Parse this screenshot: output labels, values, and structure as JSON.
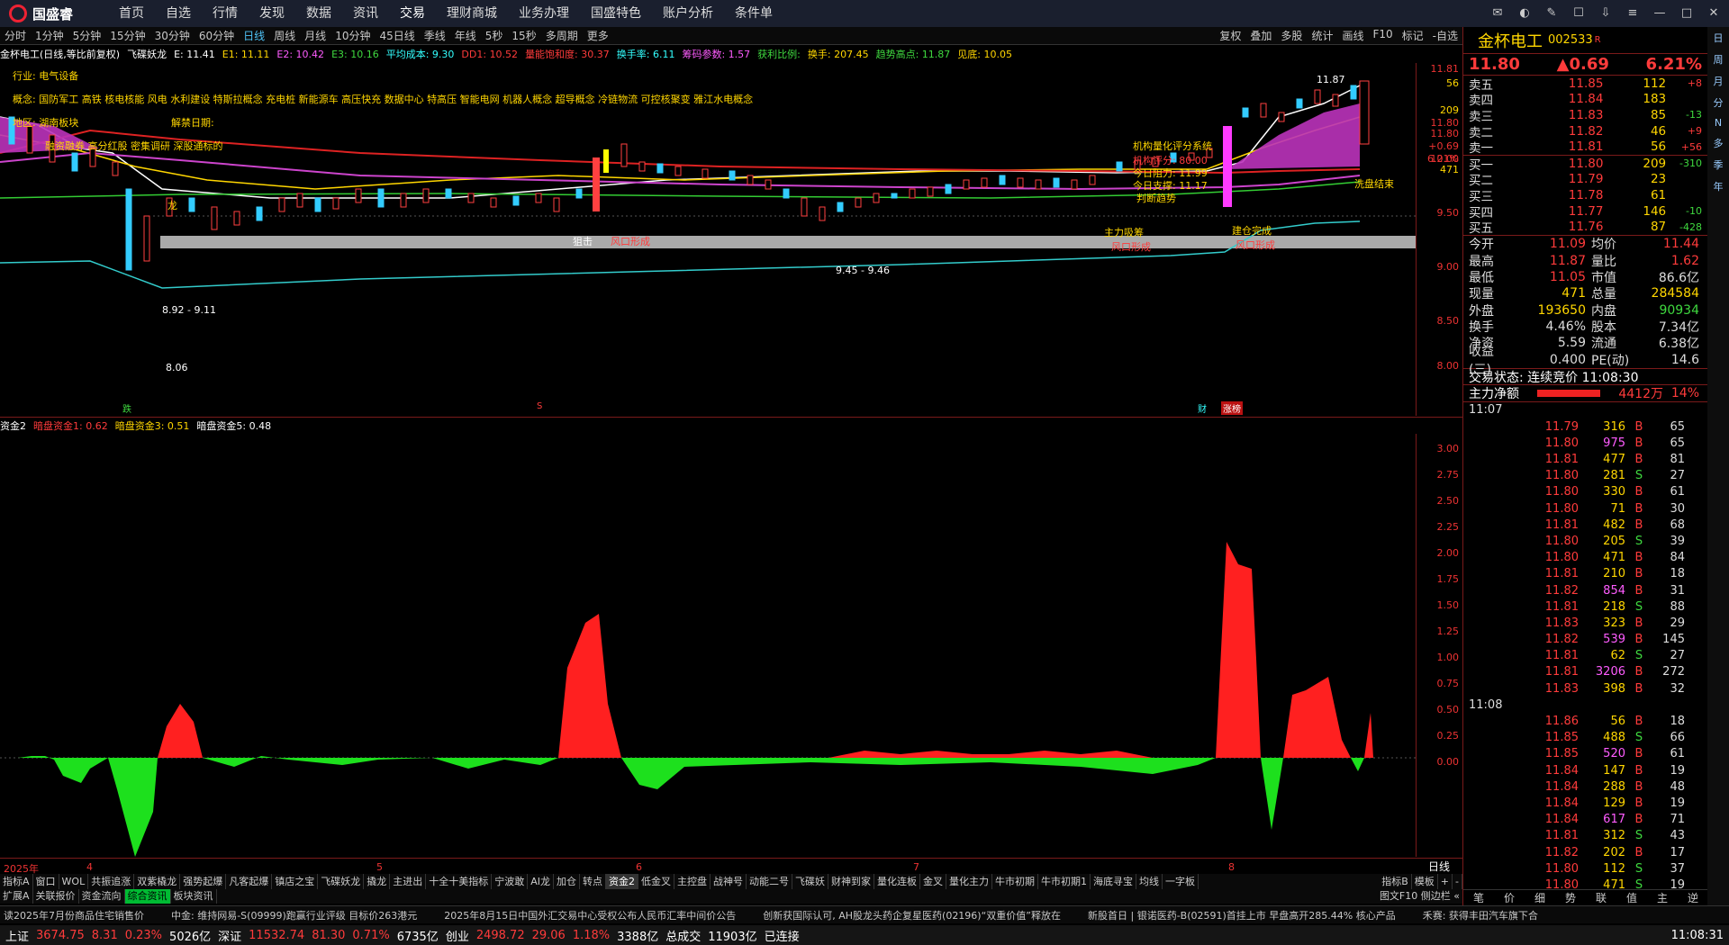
{
  "menu": {
    "logo": "国盛睿",
    "items": [
      "首页",
      "自选",
      "行情",
      "发现",
      "数据",
      "资讯",
      "交易",
      "理财商城",
      "业务办理",
      "国盛特色",
      "账户分析",
      "条件单"
    ]
  },
  "periods": {
    "items": [
      "分时",
      "1分钟",
      "5分钟",
      "15分钟",
      "30分钟",
      "60分钟",
      "日线",
      "周线",
      "月线",
      "10分钟",
      "45日线",
      "季线",
      "年线",
      "5秒",
      "15秒",
      "多周期",
      "更多"
    ],
    "right": [
      "复权",
      "叠加",
      "多股",
      "统计",
      "画线",
      "F10",
      "标记",
      "-自选"
    ]
  },
  "chartinfo": {
    "stock": "金杯电工(日线,等比前复权)",
    "ind": "飞碟妖龙",
    "e1": "E: 11.41",
    "e11": "E1: 11.11",
    "e2": "E2: 10.42",
    "e3": "E3: 10.16",
    "avgcost": "平均成本: 9.30",
    "dd1": "DD1: 10.52",
    "cap": "量能饱和度: 30.37",
    "turn": "换手率: 6.11",
    "chip": "筹码参数: 1.57",
    "profit": "获利比例:",
    "hand": "换手: 207.45",
    "trend": "趋势高点: 11.87",
    "low": "见底: 10.05"
  },
  "annot": {
    "industry": "行业: 电气设备",
    "concept": "概念: 国防军工 高铁 核电核能 风电 水利建设 特斯拉概念 充电桩 新能源车 高压快充 数据中心 特高压 智能电网 机器人概念 超导概念 冷链物流 可控核聚变 雅江水电概念",
    "region": "地区: 湖南板块",
    "unlock": "解禁日期:",
    "tags": "融资融券 高分红股 密集调研 深股通标的",
    "inst_title": "机构量化评分系统",
    "inst_score": "机构评分: 80.00",
    "resist": "今日阻力: 11.99",
    "support": "今日支撑: 11.17",
    "trend_word": "判断趋势",
    "main_buy": "主力吸筹",
    "build_done": "建仓完成",
    "wind1": "风口形成",
    "wind2": "风口形成",
    "wind3": "风口形成",
    "wash": "洗盘结束",
    "hit": "狙击",
    "low1": "8.92 - 9.11",
    "low2": "9.45 - 9.46",
    "low3": "8.06",
    "high": "11.87",
    "mark_long": "龙",
    "mark_die": "跌",
    "mark_s": "S",
    "mark_cai": "财",
    "mark_zhang": "涨榜"
  },
  "price_axis": [
    "11.81",
    "11.80",
    "10.00",
    "9.50",
    "9.00",
    "8.50",
    "8.00"
  ],
  "price_side": [
    "56",
    "209",
    "11.80",
    "+0.69",
    "6.21%",
    "471"
  ],
  "indicator": {
    "name": "资金2",
    "a": "暗盘资金1: 0.62",
    "b": "暗盘资金3: 0.51",
    "c": "暗盘资金5: 0.48"
  },
  "ind_axis": [
    "3.00",
    "2.75",
    "2.50",
    "2.25",
    "2.00",
    "1.75",
    "1.50",
    "1.25",
    "1.00",
    "0.75",
    "0.50",
    "0.25",
    "0.00"
  ],
  "dates": [
    "2025年",
    "4",
    "5",
    "6",
    "7",
    "8"
  ],
  "daily_label": "日线",
  "tabs1": [
    "指标A",
    "窗口",
    "WOL",
    "共振追涨",
    "双紫橇龙",
    "强势起爆",
    "凡客起爆",
    "镇店之宝",
    "飞碟妖龙",
    "撬龙",
    "主进出",
    "十全十美指标",
    "宁波敢",
    "AI龙",
    "加仓",
    "转点",
    "资金2",
    "低金叉",
    "主控盘",
    "战神号",
    "动能二号",
    "飞碟妖",
    "财神到家",
    "量化连板",
    "金叉",
    "量化主力",
    "牛市初期",
    "牛市初期1",
    "海底寻宝",
    "均线",
    "一字板"
  ],
  "tabs1_right": [
    "指标B",
    "模板",
    "+",
    "-"
  ],
  "tabs2": [
    "扩展A",
    "关联报价",
    "资金流向",
    "综合资讯",
    "板块资讯"
  ],
  "tabs2_right": "图文F10 侧边栏 «",
  "ticker": [
    "读2025年7月份商品住宅销售价",
    "中金: 维持网易-S(09999)跑赢行业评级 目标价263港元",
    "2025年8月15日中国外汇交易中心受权公布人民币汇率中间价公告",
    "创新获国际认可, AH股龙头药企复星医药(02196)“双重价值”释放在",
    "新股首日 | 银诺医药-B(02591)首挂上市 早盘高开285.44% 核心产品",
    "禾赛: 获得丰田汽车旗下合"
  ],
  "status": {
    "sh": "上证",
    "sh_v": "3674.75",
    "sh_c": "8.31",
    "sh_p": "0.23%",
    "sh_a": "5026亿",
    "sz": "深证",
    "sz_v": "11532.74",
    "sz_c": "81.30",
    "sz_p": "0.71%",
    "sz_a": "6735亿",
    "cy": "创业",
    "cy_v": "2498.72",
    "cy_c": "29.06",
    "cy_p": "1.18%",
    "cy_a": "3388亿",
    "total": "总成交",
    "total_v": "11903亿",
    "conn": "已连接",
    "time": "11:08:31"
  },
  "rp": {
    "name": "金杯电工",
    "code": "002533",
    "flag": "R",
    "price": "11.80",
    "chg": "▲0.69",
    "pct": "6.21%",
    "asks": [
      [
        "卖五",
        "11.85",
        "112",
        "+8"
      ],
      [
        "卖四",
        "11.84",
        "183",
        ""
      ],
      [
        "卖三",
        "11.83",
        "85",
        "-13"
      ],
      [
        "卖二",
        "11.82",
        "46",
        "+9"
      ],
      [
        "卖一",
        "11.81",
        "56",
        "+56"
      ]
    ],
    "bids": [
      [
        "买一",
        "11.80",
        "209",
        "-310"
      ],
      [
        "买二",
        "11.79",
        "23",
        ""
      ],
      [
        "买三",
        "11.78",
        "61",
        ""
      ],
      [
        "买四",
        "11.77",
        "146",
        "-10"
      ],
      [
        "买五",
        "11.76",
        "87",
        "-428"
      ]
    ],
    "stats": [
      [
        "今开",
        "11.09",
        "均价",
        "11.44"
      ],
      [
        "最高",
        "11.87",
        "量比",
        "1.62"
      ],
      [
        "最低",
        "11.05",
        "市值",
        "86.6亿"
      ],
      [
        "现量",
        "471",
        "总量",
        "284584"
      ],
      [
        "外盘",
        "193650",
        "内盘",
        "90934"
      ],
      [
        "换手",
        "4.46%",
        "股本",
        "7.34亿"
      ],
      [
        "净资",
        "5.59",
        "流通",
        "6.38亿"
      ],
      [
        "收益(三)",
        "0.400",
        "PE(动)",
        "14.6"
      ]
    ],
    "state": "交易状态: 连续竞价 11:08:30",
    "net": "主力净额",
    "net_v": "4412万",
    "net_p": "14%",
    "t1": "11:07",
    "t2": "11:08",
    "ticks1": [
      [
        "11.79",
        "316",
        "B",
        "65"
      ],
      [
        "11.80",
        "975",
        "B",
        "65"
      ],
      [
        "11.81",
        "477",
        "B",
        "81"
      ],
      [
        "11.80",
        "281",
        "S",
        "27"
      ],
      [
        "11.80",
        "330",
        "B",
        "61"
      ],
      [
        "11.80",
        "71",
        "B",
        "30"
      ],
      [
        "11.81",
        "482",
        "B",
        "68"
      ],
      [
        "11.80",
        "205",
        "S",
        "39"
      ],
      [
        "11.80",
        "471",
        "B",
        "84"
      ],
      [
        "11.81",
        "210",
        "B",
        "18"
      ],
      [
        "11.82",
        "854",
        "B",
        "31"
      ],
      [
        "11.81",
        "218",
        "S",
        "88"
      ],
      [
        "11.83",
        "323",
        "B",
        "29"
      ],
      [
        "11.82",
        "539",
        "B",
        "145"
      ],
      [
        "11.81",
        "62",
        "S",
        "27"
      ],
      [
        "11.81",
        "3206",
        "B",
        "272"
      ],
      [
        "11.83",
        "398",
        "B",
        "32"
      ]
    ],
    "ticks2": [
      [
        "11.86",
        "56",
        "B",
        "18"
      ],
      [
        "11.85",
        "488",
        "S",
        "66"
      ],
      [
        "11.85",
        "520",
        "B",
        "61"
      ],
      [
        "11.84",
        "147",
        "B",
        "19"
      ],
      [
        "11.84",
        "288",
        "B",
        "48"
      ],
      [
        "11.84",
        "129",
        "B",
        "19"
      ],
      [
        "11.84",
        "617",
        "B",
        "71"
      ],
      [
        "11.81",
        "312",
        "S",
        "43"
      ],
      [
        "11.82",
        "202",
        "B",
        "17"
      ],
      [
        "11.80",
        "112",
        "S",
        "37"
      ],
      [
        "11.80",
        "471",
        "S",
        "19"
      ]
    ],
    "bottom": [
      "笔",
      "价",
      "细",
      "势",
      "联",
      "值",
      "主",
      "逆"
    ]
  },
  "side": [
    "日",
    "周",
    "月",
    "分",
    "N",
    "多",
    "季",
    "年"
  ],
  "chart_data": {
    "type": "bar",
    "title": "资金2",
    "ylim": [
      0,
      3.1
    ],
    "x": [
      "2025年",
      "4",
      "5",
      "6",
      "7",
      "8"
    ],
    "series": [
      {
        "name": "暗盘资金1",
        "values": [
          0.62
        ]
      },
      {
        "name": "暗盘资金3",
        "values": [
          0.51
        ]
      },
      {
        "name": "暗盘资金5",
        "values": [
          0.48
        ]
      }
    ]
  }
}
